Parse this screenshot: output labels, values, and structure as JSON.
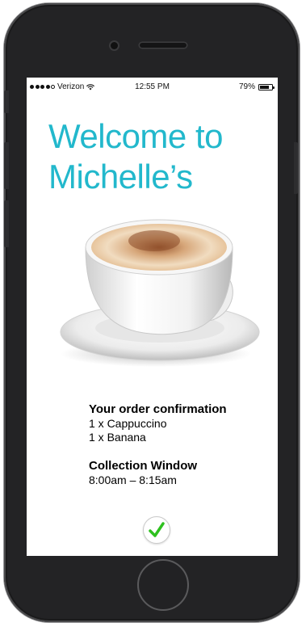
{
  "status_bar": {
    "carrier": "Verizon",
    "time": "12:55 PM",
    "battery": "79%",
    "battery_level": 0.79
  },
  "welcome": {
    "line1": "Welcome to",
    "line2": "Michelle’s",
    "color": "#22b8cc"
  },
  "order": {
    "title": "Your order confirmation",
    "items": [
      "1 x Cappuccino",
      "1 x Banana"
    ]
  },
  "collection": {
    "title": "Collection Window",
    "window": "8:00am – 8:15am"
  },
  "confirm": {
    "icon": "checkmark-icon",
    "color": "#2ec11f"
  }
}
